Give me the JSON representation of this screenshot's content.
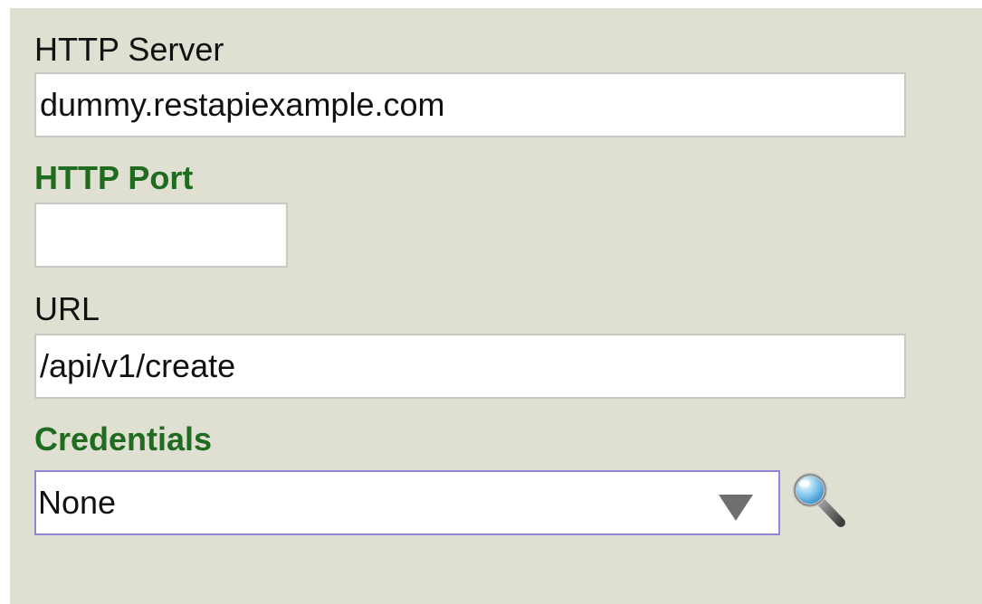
{
  "form": {
    "http_server": {
      "label": "HTTP Server",
      "value": "dummy.restapiexample.com"
    },
    "http_port": {
      "label": "HTTP Port",
      "value": ""
    },
    "url": {
      "label": "URL",
      "value": "/api/v1/create"
    },
    "credentials": {
      "label": "Credentials",
      "selected": "None",
      "dropdown_icon": "triangle-down-icon",
      "lookup_icon": "magnifier-icon"
    }
  },
  "colors": {
    "panel_background": "#dfdfd2",
    "required_label": "#1f6b1f",
    "field_border": "#c9c9c3",
    "focused_border": "#8e86d8"
  }
}
